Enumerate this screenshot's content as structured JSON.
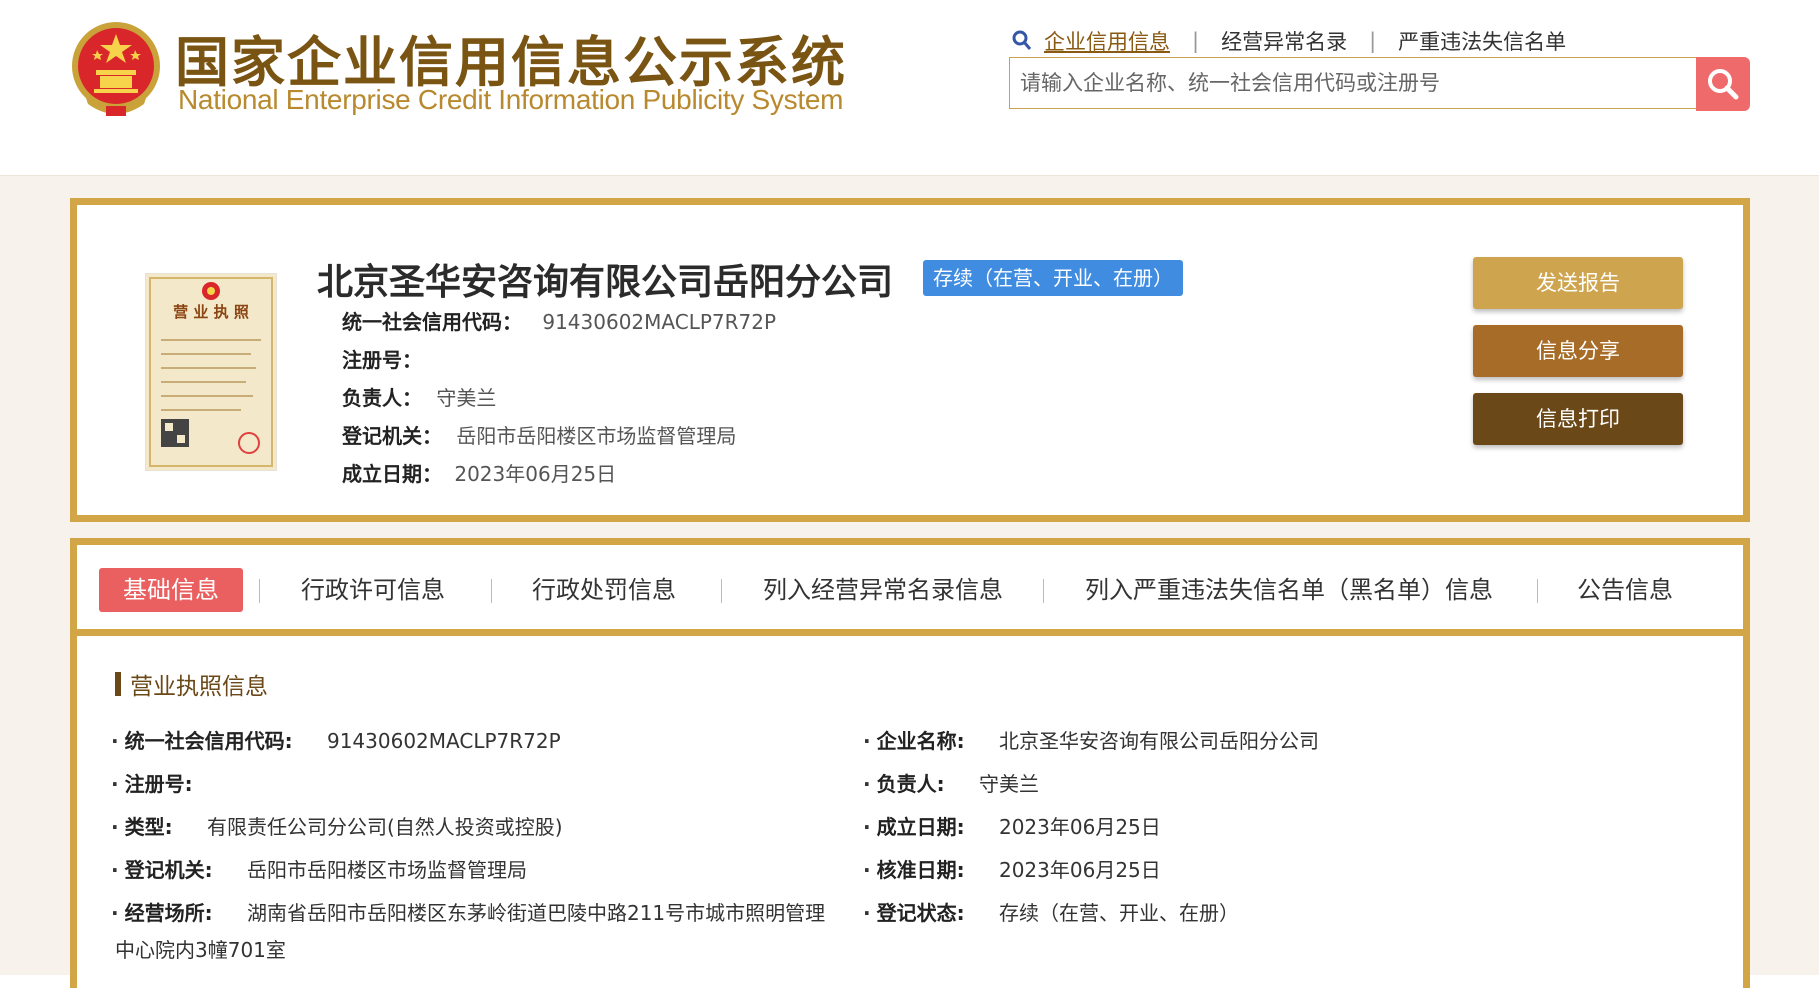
{
  "header": {
    "title_cn": "国家企业信用信息公示系统",
    "title_en": "National Enterprise Credit Information Publicity System",
    "nav": {
      "credit_info": "企业信用信息",
      "abnormal_list": "经营异常名录",
      "serious_violation_list": "严重违法失信名单"
    },
    "search": {
      "placeholder": "请输入企业名称、统一社会信用代码或注册号"
    },
    "brand_color": "#7a5412"
  },
  "company": {
    "name": "北京圣华安咨询有限公司岳阳分公司",
    "status_badge": "存续（在营、开业、在册）",
    "credit_code_label": "统一社会信用代码：",
    "credit_code": "91430602MACLP7R72P",
    "reg_no_label": "注册号：",
    "reg_no": "",
    "person_label": "负责人：",
    "person": "守美兰",
    "authority_label": "登记机关：",
    "authority": "岳阳市岳阳楼区市场监督管理局",
    "founded_label": "成立日期：",
    "founded": "2023年06月25日",
    "license_image_text": {
      "title": "营 业 执 照"
    }
  },
  "actions": {
    "send_report": "发送报告",
    "share_info": "信息分享",
    "print_info": "信息打印"
  },
  "tabs": [
    {
      "label": "基础信息",
      "active": true
    },
    {
      "label": "行政许可信息",
      "active": false
    },
    {
      "label": "行政处罚信息",
      "active": false
    },
    {
      "label": "列入经营异常名录信息",
      "active": false
    },
    {
      "label": "列入严重违法失信名单（黑名单）信息",
      "active": false
    },
    {
      "label": "公告信息",
      "active": false
    }
  ],
  "license_section": {
    "title": "营业执照信息",
    "left": [
      {
        "label": "统一社会信用代码:",
        "value": "91430602MACLP7R72P"
      },
      {
        "label": "注册号:",
        "value": ""
      },
      {
        "label": "类型:",
        "value": "有限责任公司分公司(自然人投资或控股)"
      },
      {
        "label": "登记机关:",
        "value": "岳阳市岳阳楼区市场监督管理局"
      },
      {
        "label": "经营场所:",
        "value": "湖南省岳阳市岳阳楼区东茅岭街道巴陵中路211号市城市照明管理",
        "value_cont": "中心院内3幢701室"
      }
    ],
    "right": [
      {
        "label": "企业名称:",
        "value": "北京圣华安咨询有限公司岳阳分公司"
      },
      {
        "label": "负责人:",
        "value": "守美兰"
      },
      {
        "label": "成立日期:",
        "value": "2023年06月25日"
      },
      {
        "label": "核准日期:",
        "value": "2023年06月25日"
      },
      {
        "label": "登记状态:",
        "value": "存续（在营、开业、在册）"
      }
    ]
  }
}
